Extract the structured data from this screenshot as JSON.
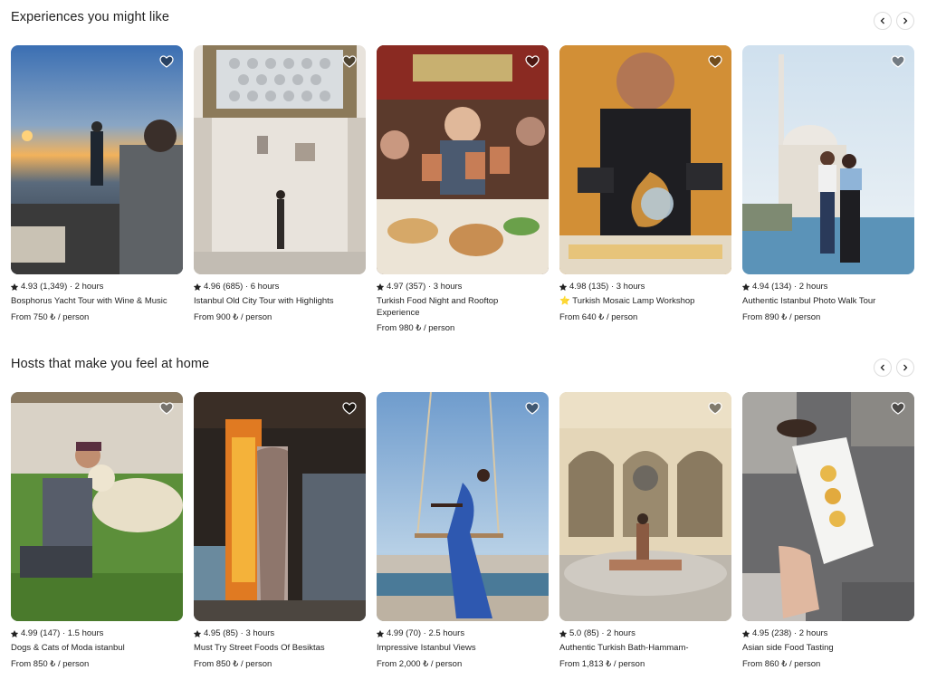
{
  "sections": [
    {
      "title": "Experiences you might like",
      "cards": [
        {
          "rating": "4.93 (1,349) · 2 hours",
          "title": "Bosphorus Yacht Tour with Wine & Music",
          "price": "From 750 ₺ / person",
          "image": "yacht-sunset"
        },
        {
          "rating": "4.96 (685) · 6 hours",
          "title": "Istanbul Old City Tour with Highlights",
          "price": "From 900 ₺ / person",
          "image": "ornate-dome-hall"
        },
        {
          "rating": "4.97 (357) · 3 hours",
          "title": "Turkish Food Night and Rooftop Experience",
          "price": "From 980 ₺ / person",
          "image": "dinner-toast"
        },
        {
          "rating": "4.98 (135) · 3 hours",
          "title": "⭐ Turkish Mosaic Lamp Workshop",
          "price": "From 640 ₺ / person",
          "image": "mosaic-lamp"
        },
        {
          "rating": "4.94 (134) · 2 hours",
          "title": "Authentic Istanbul Photo Walk Tour",
          "price": "From 890 ₺ / person",
          "image": "couple-mosque"
        }
      ]
    },
    {
      "title": "Hosts that make you feel at home",
      "cards": [
        {
          "rating": "4.99 (147) · 1.5 hours",
          "title": "Dogs & Cats of Moda istanbul",
          "price": "From 850 ₺ / person",
          "image": "man-dog-grass"
        },
        {
          "rating": "4.95 (85) · 3 hours",
          "title": "Must Try Street Foods Of Besiktas",
          "price": "From 850 ₺ / person",
          "image": "doner-grill"
        },
        {
          "rating": "4.99 (70) · 2.5 hours",
          "title": "Impressive Istanbul Views",
          "price": "From 2,000 ₺ / person",
          "image": "swing-sky"
        },
        {
          "rating": "5.0 (85) · 2 hours",
          "title": "Authentic Turkish Bath-Hammam-",
          "price": "From 1,813 ₺ / person",
          "image": "hammam"
        },
        {
          "rating": "4.95 (238) · 2 hours",
          "title": "Asian side Food Tasting",
          "price": "From 860 ₺ / person",
          "image": "street-food-hand"
        }
      ]
    }
  ],
  "icons": {
    "heart": "heart-icon",
    "star": "star-icon",
    "prev": "chevron-left-icon",
    "next": "chevron-right-icon"
  }
}
